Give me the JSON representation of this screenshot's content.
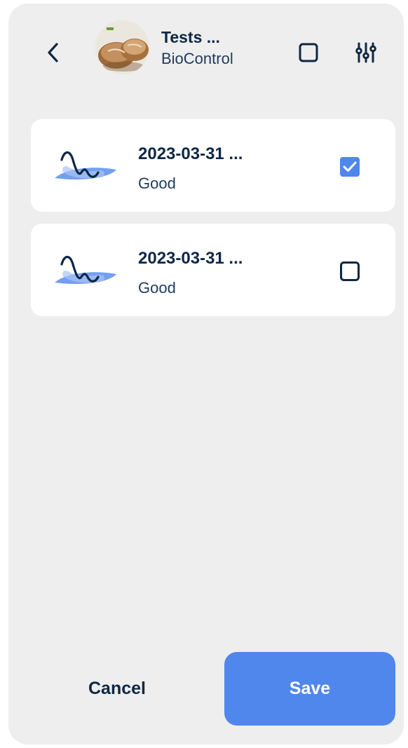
{
  "header": {
    "title": "Tests ...",
    "subtitle": "BioControl",
    "back_icon": "chevron-left-icon",
    "select_all_icon": "square-outline-icon",
    "filter_icon": "sliders-icon"
  },
  "items": [
    {
      "title": "2023-03-31 ...",
      "status": "Good",
      "checked": true
    },
    {
      "title": "2023-03-31 ...",
      "status": "Good",
      "checked": false
    }
  ],
  "footer": {
    "cancel_label": "Cancel",
    "save_label": "Save"
  },
  "colors": {
    "accent": "#5087ec",
    "text_dark": "#0f2744",
    "panel_bg": "#eeeeee",
    "card_bg": "#ffffff"
  }
}
